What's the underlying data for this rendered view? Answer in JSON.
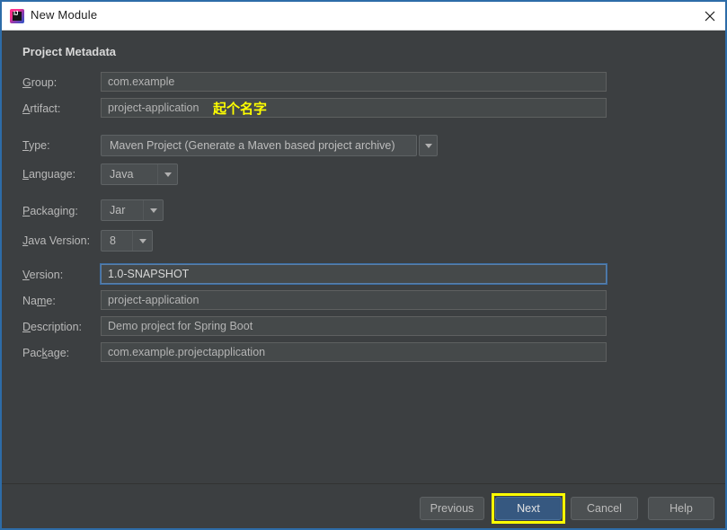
{
  "window": {
    "title": "New Module",
    "app_icon": "intellij-idea-icon",
    "close_icon": "close-icon",
    "border_color": "#2d6ca8",
    "background": "#3c3f41"
  },
  "section": {
    "title": "Project Metadata"
  },
  "fields": [
    {
      "label": "Group:",
      "mnemonic": "G",
      "value": "com.example",
      "kind": "text",
      "name": "group",
      "focused": false
    },
    {
      "label": "Artifact:",
      "mnemonic": "A",
      "value": "project-application",
      "kind": "text",
      "name": "artifact",
      "focused": false
    },
    {
      "label": "Type:",
      "mnemonic": "T",
      "value": "Maven Project (Generate a Maven based project archive)",
      "kind": "combo-split",
      "name": "type",
      "focused": false
    },
    {
      "label": "Language:",
      "mnemonic": "L",
      "value": "Java",
      "kind": "combo",
      "name": "language",
      "focused": false
    },
    {
      "label": "Packaging:",
      "mnemonic": "P",
      "value": "Jar",
      "kind": "combo",
      "name": "packaging",
      "focused": false
    },
    {
      "label": "Java Version:",
      "mnemonic": "J",
      "value": "8",
      "kind": "combo",
      "name": "java-version",
      "focused": false
    },
    {
      "label": "Version:",
      "mnemonic": "V",
      "value": "1.0-SNAPSHOT",
      "kind": "text",
      "name": "version",
      "focused": true
    },
    {
      "label": "Name:",
      "mnemonic": "m",
      "value": "project-application",
      "kind": "text",
      "name": "name",
      "focused": false
    },
    {
      "label": "Description:",
      "mnemonic": "D",
      "value": "Demo project for Spring Boot",
      "kind": "text",
      "name": "description",
      "focused": false
    },
    {
      "label": "Package:",
      "mnemonic": "k",
      "value": "com.example.projectapplication",
      "kind": "text",
      "name": "package",
      "focused": false
    }
  ],
  "annotations": [
    {
      "text": "起个名字",
      "color": "#ffff00",
      "target": "artifact-field"
    }
  ],
  "buttons": {
    "previous": "Previous",
    "next": "Next",
    "cancel": "Cancel",
    "help": "Help",
    "next_highlighted": true,
    "highlight_color": "#ffff00",
    "primary_color": "#365880"
  }
}
